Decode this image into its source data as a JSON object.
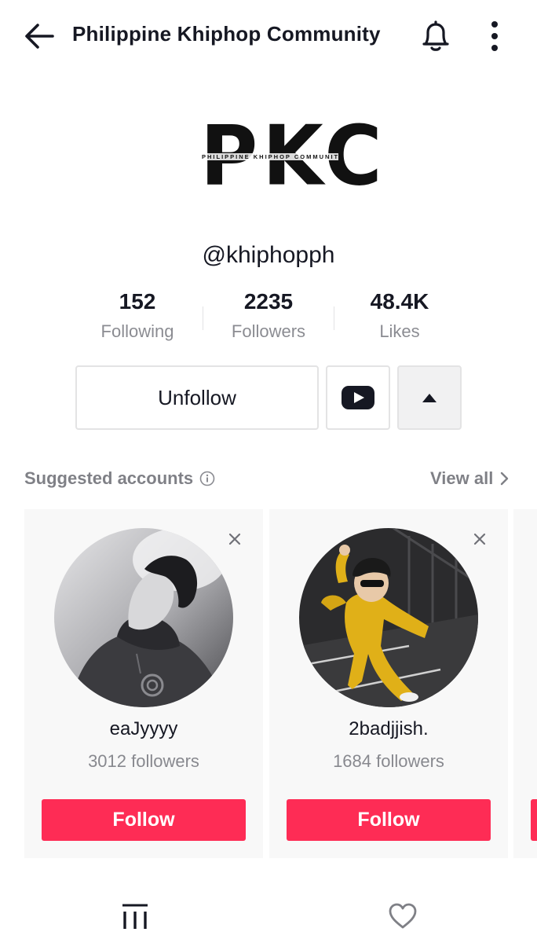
{
  "header": {
    "title": "Philippine Khiphop Community"
  },
  "logo": {
    "text": "PKC",
    "tagline": "PHILIPPINE KHIPHOP COMMUNITY"
  },
  "profile": {
    "username": "@khiphopph"
  },
  "stats": [
    {
      "value": "152",
      "label": "Following"
    },
    {
      "value": "2235",
      "label": "Followers"
    },
    {
      "value": "48.4K",
      "label": "Likes"
    }
  ],
  "actions": {
    "unfollow_label": "Unfollow"
  },
  "suggested": {
    "title": "Suggested accounts",
    "view_all": "View all",
    "accounts": [
      {
        "name": "eaJyyyy",
        "followers": "3012 followers",
        "follow_label": "Follow"
      },
      {
        "name": "2badjjish.",
        "followers": "1684 followers",
        "follow_label": "Follow"
      }
    ]
  },
  "colors": {
    "accent": "#fe2c55",
    "text": "#161823"
  },
  "icons": {
    "back": "arrow-left-icon",
    "bell": "bell-icon",
    "more": "more-vertical-icon",
    "youtube": "youtube-icon",
    "toggle": "triangle-up-icon",
    "info": "info-icon",
    "chevron": "chevron-right-icon",
    "close": "close-icon",
    "grid": "videos-grid-icon",
    "heart": "heart-icon"
  }
}
